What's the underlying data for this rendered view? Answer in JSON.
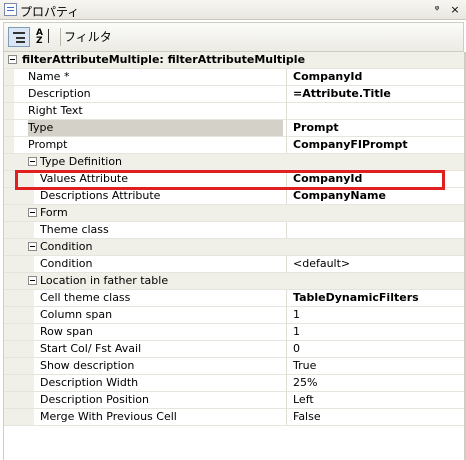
{
  "window": {
    "title": "プロパティ",
    "pin_glyph": "ᵠ",
    "close_glyph": "×"
  },
  "toolbar": {
    "az_label_top": "A",
    "az_label_bottom": "Z",
    "filter_label": "フィルタ"
  },
  "grid": {
    "header": "filterAttributeMultiple: filterAttributeMultiple",
    "rows": [
      {
        "name": "Name *",
        "value": "CompanyId",
        "bold": true
      },
      {
        "name": "Description",
        "value": "=Attribute.Title",
        "bold": true
      },
      {
        "name": "Right Text",
        "value": "",
        "bold": false
      },
      {
        "name": "Type",
        "value": "Prompt",
        "bold": true
      },
      {
        "name": "Prompt",
        "value": "CompanyFIPrompt",
        "bold": true
      }
    ],
    "type_definition": {
      "label": "Type Definition",
      "rows": [
        {
          "name": "Values Attribute",
          "value": "CompanyId",
          "bold": true
        },
        {
          "name": "Descriptions Attribute",
          "value": "CompanyName",
          "bold": true
        }
      ]
    },
    "form": {
      "label": "Form",
      "rows": [
        {
          "name": "Theme class",
          "value": "",
          "bold": false
        }
      ]
    },
    "condition": {
      "label": "Condition",
      "rows": [
        {
          "name": "Condition",
          "value": "<default>",
          "bold": false
        }
      ]
    },
    "location": {
      "label": "Location in father table",
      "rows": [
        {
          "name": "Cell theme class",
          "value": "TableDynamicFilters",
          "bold": true
        },
        {
          "name": "Column span",
          "value": "1",
          "bold": false
        },
        {
          "name": "Row span",
          "value": "1",
          "bold": false
        },
        {
          "name": "Start Col/ Fst Avail",
          "value": "0",
          "bold": false
        },
        {
          "name": "Show description",
          "value": "True",
          "bold": false
        },
        {
          "name": "Description Width",
          "value": "25%",
          "bold": false
        },
        {
          "name": "Description Position",
          "value": "Left",
          "bold": false
        },
        {
          "name": "Merge With Previous Cell",
          "value": "False",
          "bold": false
        }
      ]
    }
  },
  "colors": {
    "highlight": "#e02020",
    "category_background": "#f0efe8"
  }
}
